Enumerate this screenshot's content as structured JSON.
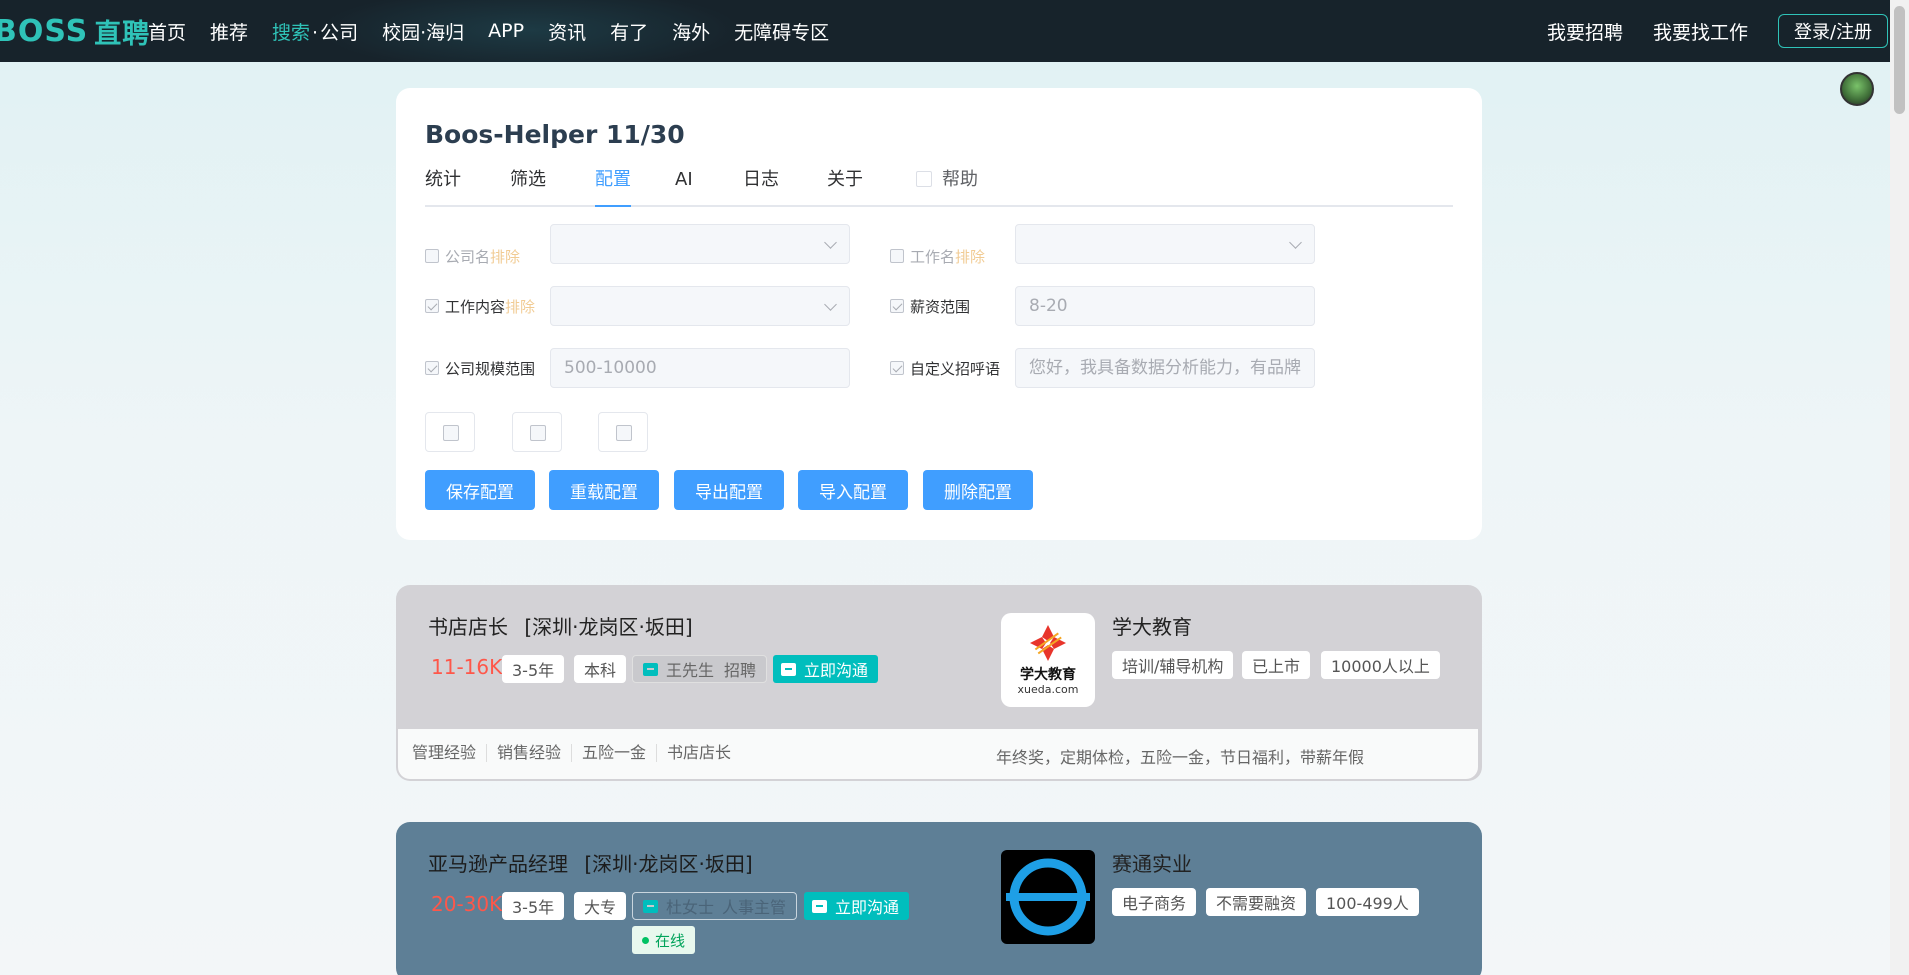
{
  "nav": {
    "logo_en": "BOSS",
    "logo_zh": "直聘",
    "items": [
      "首页",
      "推荐",
      "搜索",
      "公司",
      "校园·海归",
      "APP",
      "资讯",
      "有了",
      "海外",
      "无障碍专区"
    ],
    "search_sep": "·",
    "right": [
      "我要招聘",
      "我要找工作"
    ],
    "login": "登录/注册"
  },
  "helper": {
    "title": "Boos-Helper 11/30",
    "tabs": [
      "统计",
      "筛选",
      "配置",
      "AI",
      "日志",
      "关于"
    ],
    "active_tab": "配置",
    "help_label": "帮助",
    "fields": {
      "company_name_label": "公司名",
      "company_name_ex": "排除",
      "job_name_label": "工作名",
      "job_name_ex": "排除",
      "job_content_label": "工作内容",
      "job_content_ex": "排除",
      "salary_label": "薪资范围",
      "salary_value": "8-20",
      "scale_label": "公司规模范围",
      "scale_value": "500-10000",
      "greeting_label": "自定义招呼语",
      "greeting_value": "您好，我具备数据分析能力，有品牌"
    },
    "buttons": [
      "保存配置",
      "重载配置",
      "导出配置",
      "导入配置",
      "删除配置"
    ]
  },
  "jobs": [
    {
      "title": "书店店长",
      "location": "[深圳·龙岗区·坂田]",
      "salary": "11-16K",
      "exp": "3-5年",
      "edu": "本科",
      "boss": "王先生",
      "boss_role": "招聘",
      "chat": "立即沟通",
      "company": "学大教育",
      "company_tags": [
        "培训/辅导机构",
        "已上市",
        "10000人以上"
      ],
      "logo_text": "学大教育",
      "logo_sub": "xueda.com",
      "skills": [
        "管理经验",
        "销售经验",
        "五险一金",
        "书店店长"
      ],
      "welfare": "年终奖，定期体检，五险一金，节日福利，带薪年假"
    },
    {
      "title": "亚马逊产品经理",
      "location": "[深圳·龙岗区·坂田]",
      "salary": "20-30K",
      "exp": "3-5年",
      "edu": "大专",
      "boss": "杜女士",
      "boss_role": "人事主管",
      "chat": "立即沟通",
      "online": "在线",
      "company": "赛通实业",
      "company_tags": [
        "电子商务",
        "不需要融资",
        "100-499人"
      ]
    }
  ],
  "colors": {
    "accent": "#409eff",
    "brand": "#2fc3b8",
    "salary": "#fe574a",
    "chat": "#00bebd"
  }
}
